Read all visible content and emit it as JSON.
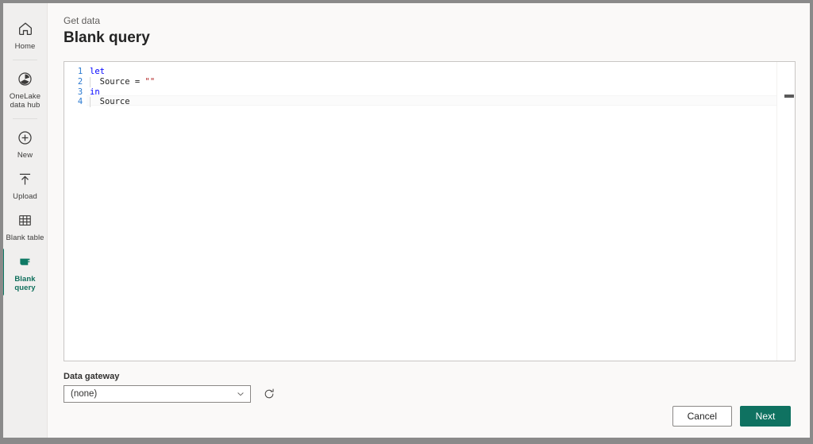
{
  "sidebar": {
    "items": [
      {
        "label": "Home",
        "icon": "home-icon",
        "selected": false
      },
      {
        "label": "OneLake\ndata hub",
        "label_line1": "OneLake",
        "label_line2": "data hub",
        "icon": "onelake-icon",
        "selected": false
      },
      {
        "label": "New",
        "icon": "plus-circle-icon",
        "selected": false
      },
      {
        "label": "Upload",
        "icon": "upload-icon",
        "selected": false
      },
      {
        "label": "Blank table",
        "icon": "table-grid-icon",
        "selected": false
      },
      {
        "label": "Blank query",
        "icon": "blank-query-icon",
        "selected": true
      }
    ]
  },
  "header": {
    "subtitle": "Get data",
    "title": "Blank query"
  },
  "editor": {
    "lines": [
      {
        "number": "1",
        "indented": false,
        "tokens": [
          {
            "text": "let",
            "type": "kw"
          }
        ]
      },
      {
        "number": "2",
        "indented": true,
        "tokens": [
          {
            "text": "  Source = ",
            "type": "id"
          },
          {
            "text": "\"\"",
            "type": "str"
          }
        ]
      },
      {
        "number": "3",
        "indented": false,
        "tokens": [
          {
            "text": "in",
            "type": "kw"
          }
        ]
      },
      {
        "number": "4",
        "indented": true,
        "tokens": [
          {
            "text": "  Source",
            "type": "id"
          }
        ]
      }
    ]
  },
  "gateway": {
    "label": "Data gateway",
    "value": "(none)",
    "options": [
      "(none)"
    ],
    "refresh_icon": "refresh-icon",
    "chevron_icon": "chevron-down-icon"
  },
  "footer": {
    "cancel_label": "Cancel",
    "next_label": "Next"
  },
  "colors": {
    "accent": "#0f7261",
    "selection_bar": "#0f7a65",
    "sidebar_bg": "#f0efee",
    "content_bg": "#faf9f8",
    "keyword": "#0000ff",
    "string": "#b02020",
    "line_number": "#2b7ad1"
  }
}
